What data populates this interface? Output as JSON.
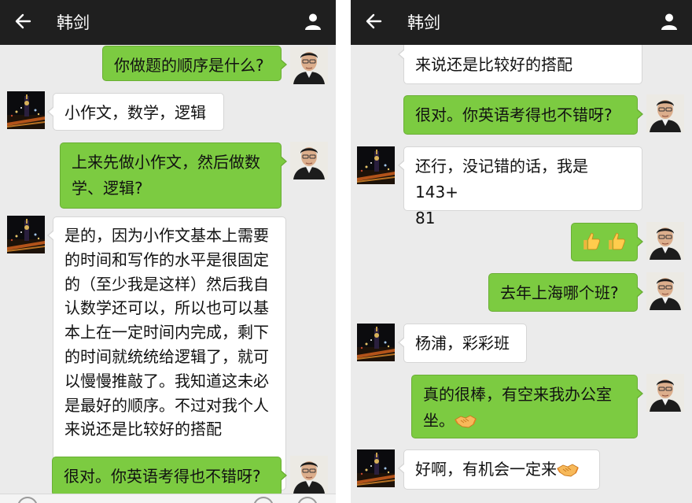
{
  "header": {
    "title": "韩剑",
    "back_icon": "arrow-left-icon",
    "profile_icon": "person-icon"
  },
  "colors": {
    "topbar": "#1f1f1f",
    "chat_bg": "#ebebeb",
    "bubble_out": "#7ccb41",
    "bubble_in": "#ffffff"
  },
  "left_panel": {
    "messages": [
      {
        "from": "me",
        "text": "你做题的顺序是什么?"
      },
      {
        "from": "contact",
        "text": "小作文，数学，逻辑"
      },
      {
        "from": "me",
        "lines": [
          "上来先做小作文，然后做数",
          "学、逻辑?"
        ]
      },
      {
        "from": "contact",
        "lines": [
          "是的，因为小作文基本上需要",
          "的时间和写作的水平是很固定",
          "的（至少我是这样）然后我自",
          "认数学还可以，所以也可以基",
          "本上在一定时间内完成，剩下",
          "的时间就统统给逻辑了，就可",
          "以慢慢推敲了。我知道这未必",
          "是最好的顺序。不过对我个人",
          "来说还是比较好的搭配"
        ]
      },
      {
        "from": "me",
        "text": "很对。你英语考得也不错呀?"
      }
    ]
  },
  "right_panel": {
    "messages": [
      {
        "from": "contact",
        "text": "来说还是比较好的搭配"
      },
      {
        "from": "me",
        "text": "很对。你英语考得也不错呀?"
      },
      {
        "from": "contact",
        "lines": [
          "还行，没记错的话，我是143+",
          "81"
        ]
      },
      {
        "from": "me",
        "emoji": "thumbs-up-icon"
      },
      {
        "from": "me",
        "text": "去年上海哪个班?"
      },
      {
        "from": "contact",
        "text": "杨浦，彩彩班"
      },
      {
        "from": "me",
        "lines": [
          "真的很棒，有空来我办公室",
          "坐。"
        ],
        "emoji": "handshake-icon"
      },
      {
        "from": "contact",
        "text": "好啊，有机会一定来",
        "emoji": "handshake-icon"
      }
    ]
  }
}
